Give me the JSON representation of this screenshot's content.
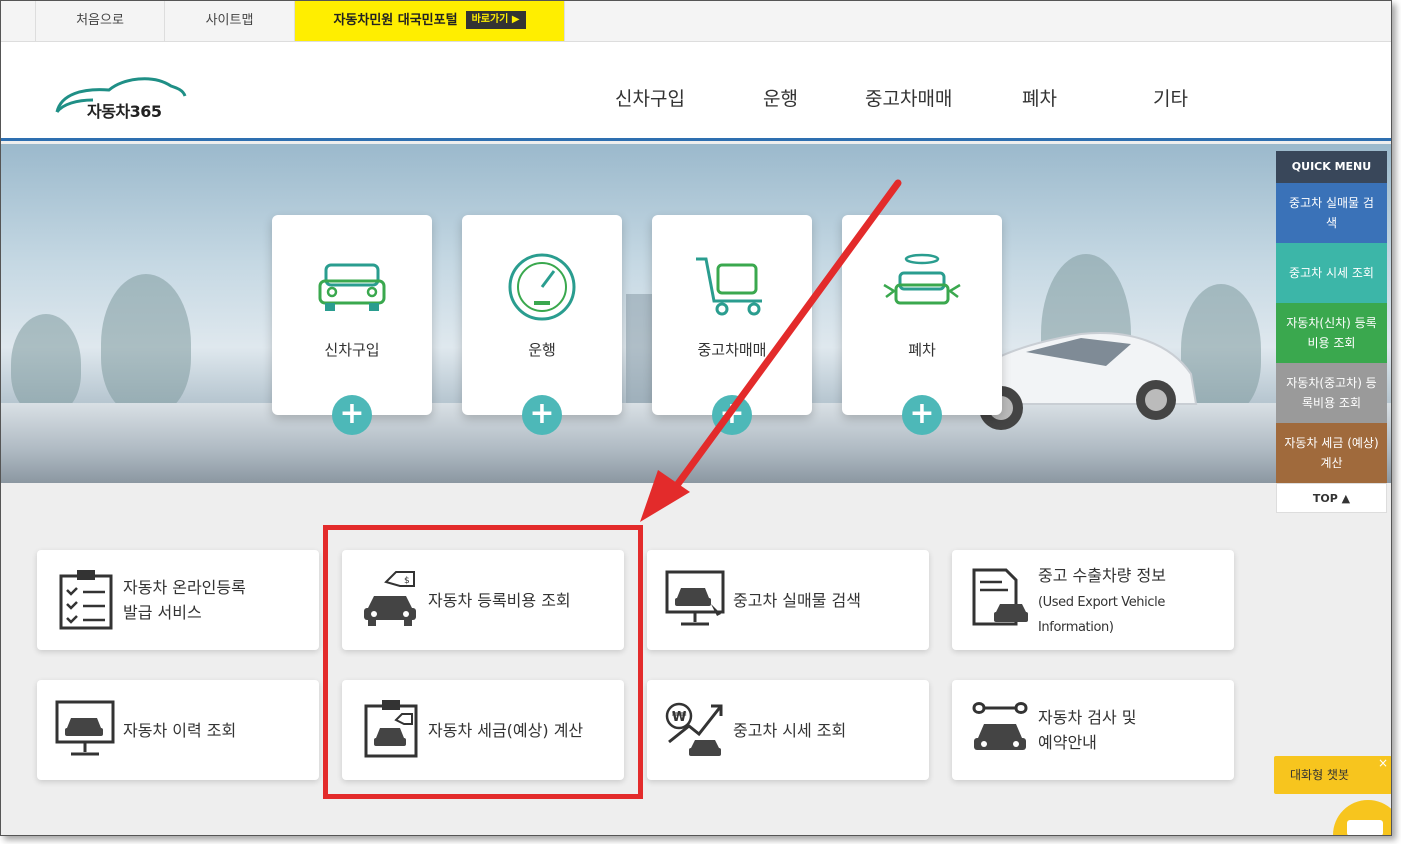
{
  "utility_bar": {
    "home": "처음으로",
    "sitemap": "사이트맵",
    "portal": "자동차민원 대국민포털",
    "portal_go": "바로가기 ▶"
  },
  "logo": {
    "text": "자동차365"
  },
  "nav": [
    "신차구입",
    "운행",
    "중고차매매",
    "폐차",
    "기타"
  ],
  "categories": [
    {
      "label": "신차구입",
      "icon": "car-front-icon"
    },
    {
      "label": "운행",
      "icon": "speedometer-icon"
    },
    {
      "label": "중고차매매",
      "icon": "shopping-cart-car-icon"
    },
    {
      "label": "폐차",
      "icon": "angel-car-icon"
    }
  ],
  "category_plus": "+",
  "quick_menu": {
    "title": "QUICK MENU",
    "items": [
      "중고차 실매물 검색",
      "중고차 시세 조회",
      "자동차(신차) 등록비용 조회",
      "자동차(중고차) 등록비용 조회",
      "자동차 세금 (예상) 계산"
    ],
    "top": "TOP ▲"
  },
  "services": [
    {
      "label_line1": "자동차 온라인등록",
      "label_line2": "발급 서비스",
      "icon": "clipboard-checklist-icon"
    },
    {
      "label_line1": "자동차 등록비용 조회",
      "label_line2": "",
      "icon": "car-price-tag-icon"
    },
    {
      "label_line1": "중고차 실매물 검색",
      "label_line2": "",
      "icon": "monitor-car-search-icon"
    },
    {
      "label_line1": "중고 수출차량 정보",
      "label_line2": "(Used Export Vehicle",
      "label_line3": "Information)",
      "icon": "document-car-icon"
    },
    {
      "label_line1": "자동차 이력 조회",
      "label_line2": "",
      "icon": "monitor-car-icon"
    },
    {
      "label_line1": "자동차 세금(예상) 계산",
      "label_line2": "",
      "icon": "clipboard-car-icon"
    },
    {
      "label_line1": "중고차 시세 조회",
      "label_line2": "",
      "icon": "won-trend-car-icon"
    },
    {
      "label_line1": "자동차 검사 및",
      "label_line2": "예약안내",
      "icon": "wrench-car-icon"
    }
  ],
  "chatbot": {
    "label": "대화형 챗봇",
    "close": "×"
  },
  "colors": {
    "portal_yellow": "#ffee00",
    "header_rule": "#2e6fb0",
    "teal": "#4db8b8",
    "annotation_red": "#e32b2b",
    "chatbot": "#f7c51e"
  }
}
